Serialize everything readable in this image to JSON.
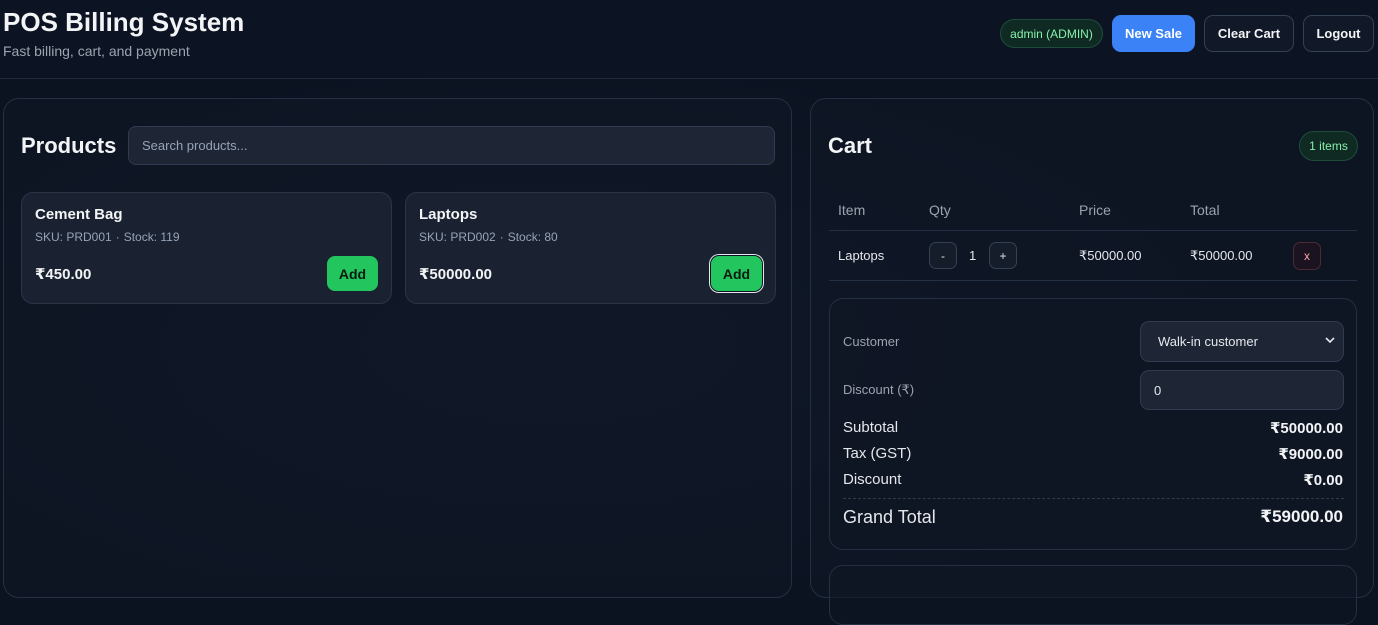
{
  "header": {
    "title": "POS Billing System",
    "subtitle": "Fast billing, cart, and payment",
    "user_badge": "admin (ADMIN)",
    "new_sale_label": "New Sale",
    "clear_cart_label": "Clear Cart",
    "logout_label": "Logout"
  },
  "products": {
    "heading": "Products",
    "search_placeholder": "Search products...",
    "items": [
      {
        "name": "Cement Bag",
        "sku_label": "SKU: PRD001",
        "stock_label": "Stock: 119",
        "price": "₹450.00",
        "add_label": "Add"
      },
      {
        "name": "Laptops",
        "sku_label": "SKU: PRD002",
        "stock_label": "Stock: 80",
        "price": "₹50000.00",
        "add_label": "Add"
      }
    ]
  },
  "cart": {
    "heading": "Cart",
    "items_badge": "1 items",
    "columns": [
      "Item",
      "Qty",
      "Price",
      "Total"
    ],
    "rows": [
      {
        "item": "Laptops",
        "qty": "1",
        "price": "₹50000.00",
        "total": "₹50000.00",
        "decrement": "-",
        "increment": "+",
        "remove": "x"
      }
    ],
    "customer_label": "Customer",
    "customer_value": "Walk-in customer",
    "discount_label": "Discount (₹)",
    "discount_value": "0",
    "subtotal_label": "Subtotal",
    "subtotal_value": "₹50000.00",
    "tax_label": "Tax (GST)",
    "tax_value": "₹9000.00",
    "discount_row_label": "Discount",
    "discount_row_value": "₹0.00",
    "grand_total_label": "Grand Total",
    "grand_total_value": "₹59000.00"
  }
}
